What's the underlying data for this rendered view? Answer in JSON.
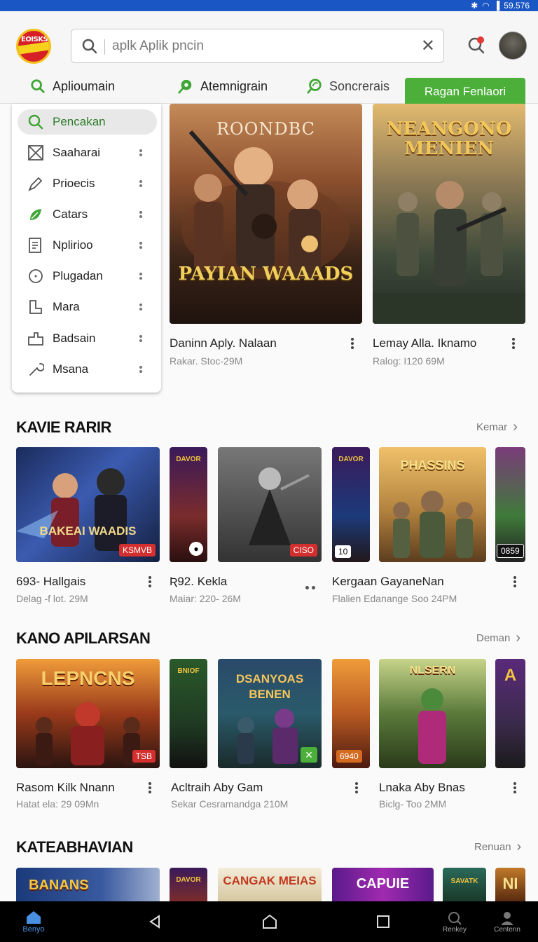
{
  "status_bar": {
    "battery_text": "59.576"
  },
  "app_bar": {
    "logo_text": "EOISKS",
    "search_placeholder": "aplk Aplik pncin",
    "tabs": [
      {
        "label": "Aplioumain",
        "icon": "search-icon"
      },
      {
        "label": "Atemnigrain",
        "icon": "leaf-search-icon"
      },
      {
        "label": "Soncrerais",
        "icon": "leaf-search-icon"
      }
    ],
    "cta_label": "Ragan Fenlaori"
  },
  "drawer": {
    "items": [
      {
        "label": "Pencakan",
        "icon": "search-icon",
        "selected": true
      },
      {
        "label": "Saaharai",
        "icon": "box-x-icon"
      },
      {
        "label": "Prioecis",
        "icon": "pen-icon"
      },
      {
        "label": "Catars",
        "icon": "leaf-icon"
      },
      {
        "label": "Nplirioo",
        "icon": "list-doc-icon"
      },
      {
        "label": "Plugadan",
        "icon": "circle-icon"
      },
      {
        "label": "Mara",
        "icon": "doc-icon"
      },
      {
        "label": "Badsain",
        "icon": "box-icon"
      },
      {
        "label": "Msana",
        "icon": "wrench-icon"
      }
    ]
  },
  "featured": [
    {
      "title": "Daninn Aply. Nalaan",
      "subtitle": "Rakar. Stoc-29M",
      "art_top": "ROONDBC",
      "art_bottom": "PAYIAN WAAADS"
    },
    {
      "title": "Lemay Alla. Iknamo",
      "subtitle": "Ralog: I120 69M",
      "art_top": "NEANGONO MENIEN"
    }
  ],
  "sections": [
    {
      "title": "KAVIE RARIR",
      "more": "Kemar",
      "thumbs": [
        {
          "art": "BAKEAI WAADIS",
          "badge": "KSMVB"
        },
        {
          "art": "DAVOR",
          "badge": ""
        },
        {
          "art": "",
          "badge": "CISO"
        },
        {
          "art": "DAVOR",
          "badge": "10"
        },
        {
          "art": "PHASSINS",
          "badge": ""
        },
        {
          "art": "",
          "badge": "0859"
        }
      ],
      "items": [
        {
          "title": "693- Hallgais",
          "subtitle": "Delag -f lot. 29M"
        },
        {
          "title": "Ʀ92. Kekla",
          "subtitle": "Maiar: 220- 26M"
        },
        {
          "title": "Kergaan GayaneNan",
          "subtitle": "Flalien Edanange Soo 24PM"
        }
      ]
    },
    {
      "title": "KANO APILARSAN",
      "more": "Deman",
      "thumbs": [
        {
          "art": "LEPNCNS",
          "badge": "TSB"
        },
        {
          "art": "BNIOF",
          "badge": ""
        },
        {
          "art": "DSANYOAS BENEN",
          "badge": ""
        },
        {
          "art": "",
          "badge": "6940"
        },
        {
          "art": "NLSERN",
          "badge": ""
        },
        {
          "art": "A",
          "badge": ""
        }
      ],
      "items": [
        {
          "title": "Rasom Kilk Nnann",
          "subtitle": "Hatat ela: 29 09Mn"
        },
        {
          "title": "Acltraih Aby Gam",
          "subtitle": "Sekar Cesramandga 210M"
        },
        {
          "title": "Lnaka Aby Bnas",
          "subtitle": "Biclg- Too 2MM"
        }
      ]
    },
    {
      "title": "KATEABHAVIAN",
      "more": "Renuan",
      "thumbs": [
        {
          "art": "BANANS"
        },
        {
          "art": "DAVOR"
        },
        {
          "art": "CANGAK MEIAS"
        },
        {
          "art": "CAPUIE"
        },
        {
          "art": "SAVATK"
        },
        {
          "art": "NI"
        }
      ]
    }
  ],
  "bottom_nav": {
    "home_label": "Benyo",
    "search_label": "Renkey",
    "account_label": "Centenn"
  },
  "colors": {
    "accent_green": "#4caf3a",
    "status_blue": "#1a56c4"
  }
}
